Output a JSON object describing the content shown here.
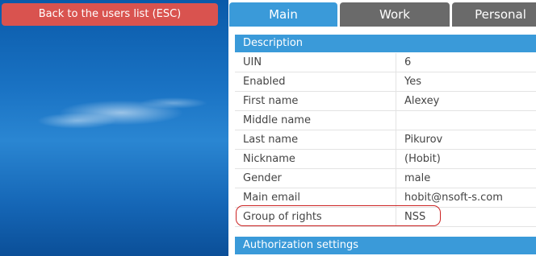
{
  "back_button": {
    "label": "Back to the users list (ESC)"
  },
  "tabs": [
    {
      "label": "Main",
      "active": true
    },
    {
      "label": "Work",
      "active": false
    },
    {
      "label": "Personal",
      "active": false
    }
  ],
  "sections": {
    "description": {
      "title": "Description"
    },
    "authorization": {
      "title": "Authorization settings"
    }
  },
  "fields": [
    {
      "label": "UIN",
      "value": "6"
    },
    {
      "label": "Enabled",
      "value": "Yes"
    },
    {
      "label": "First name",
      "value": "Alexey"
    },
    {
      "label": "Middle name",
      "value": ""
    },
    {
      "label": "Last name",
      "value": "Pikurov"
    },
    {
      "label": "Nickname",
      "value": "(Hobit)"
    },
    {
      "label": "Gender",
      "value": "male"
    },
    {
      "label": "Main email",
      "value": "hobit@nsoft-s.com"
    },
    {
      "label": "Group of rights",
      "value": "NSS"
    }
  ],
  "colors": {
    "accent": "#3a9ad9",
    "inactive_tab": "#6a6a6a",
    "back_button": "#d9534f",
    "highlight_outline": "#cc2222"
  }
}
